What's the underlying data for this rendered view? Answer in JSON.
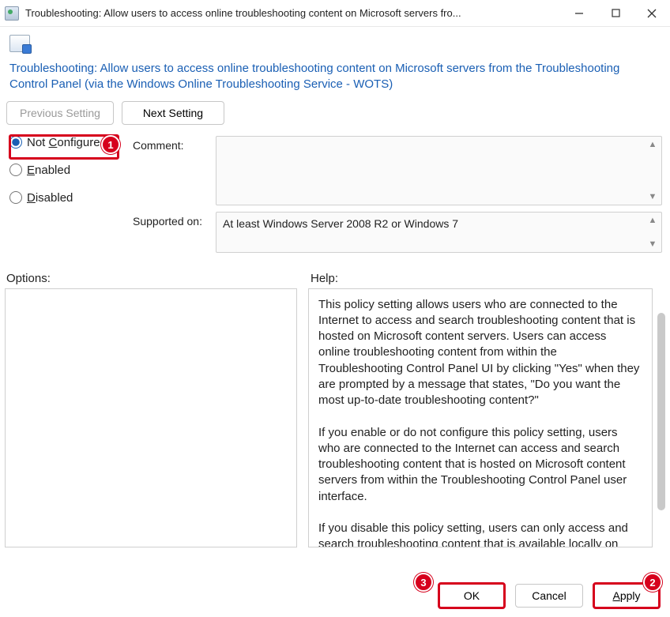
{
  "window": {
    "title_truncated": "Troubleshooting: Allow users to access online troubleshooting content on Microsoft servers fro..."
  },
  "policy": {
    "full_title": "Troubleshooting: Allow users to access online troubleshooting content on Microsoft servers from the Troubleshooting Control Panel (via the Windows Online Troubleshooting Service - WOTS)"
  },
  "nav": {
    "previous": "Previous Setting",
    "next": "Next Setting"
  },
  "state": {
    "labels": {
      "not_configured": "Not Configured",
      "enabled": "Enabled",
      "disabled": "Disabled"
    },
    "selected": "not_configured"
  },
  "meta": {
    "comment_label": "Comment:",
    "comment_value": "",
    "supported_label": "Supported on:",
    "supported_value": "At least Windows Server 2008 R2 or Windows 7"
  },
  "sections": {
    "options_label": "Options:",
    "help_label": "Help:"
  },
  "help_text": "This policy setting allows users who are connected to the Internet to access and search troubleshooting content that is hosted on Microsoft content servers. Users can access online troubleshooting content from within the Troubleshooting Control Panel UI by clicking \"Yes\" when they are prompted by a message that states, \"Do you want the most up-to-date troubleshooting content?\"\n\nIf you enable or do not configure this policy setting, users who are connected to the Internet can access and search troubleshooting content that is hosted on Microsoft content servers from within the Troubleshooting Control Panel user interface.\n\nIf you disable this policy setting, users can only access and search troubleshooting content that is available locally on their",
  "footer": {
    "ok": "OK",
    "cancel": "Cancel",
    "apply": "Apply"
  },
  "annotations": {
    "b1": "1",
    "b2": "2",
    "b3": "3"
  }
}
